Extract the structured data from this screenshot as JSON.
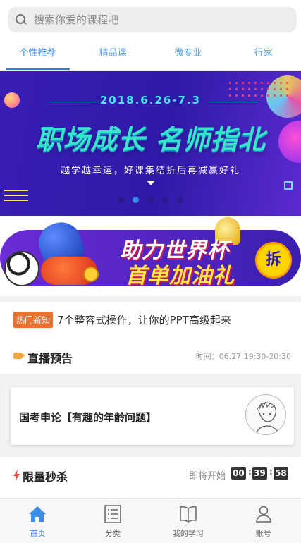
{
  "search": {
    "placeholder": "搜索你爱的课程吧"
  },
  "tabs": [
    {
      "label": "个性推荐",
      "active": true
    },
    {
      "label": "精品课"
    },
    {
      "label": "微专业"
    },
    {
      "label": "行家"
    }
  ],
  "banner": {
    "date": "2018.6.26-7.3",
    "title": "职场成长 名师指北",
    "subtitle": "越学越幸运，好课集结折后再减赢好礼",
    "slide_count": 5,
    "active_slide": 2
  },
  "promo": {
    "line1": "助力世界杯",
    "line2": "首单加油礼",
    "badge": "拆"
  },
  "news": {
    "tag": "热门新知",
    "text": "7个整容式操作，让你的PPT高级起来"
  },
  "live": {
    "label": "直播预告",
    "time": "时间：06.27 19:30-20:30",
    "card_title": "国考申论【有趣的年龄问题】"
  },
  "flash_sale": {
    "label": "限量秒杀",
    "status": "即将开始",
    "hours": "00",
    "minutes": "39",
    "seconds": "58"
  },
  "nav": [
    {
      "label": "首页",
      "icon": "home-icon",
      "active": true
    },
    {
      "label": "分类",
      "icon": "list-icon"
    },
    {
      "label": "我的学习",
      "icon": "book-icon"
    },
    {
      "label": "账号",
      "icon": "user-icon"
    }
  ],
  "colors": {
    "accent": "#2f7fe0",
    "tag": "#e8722f",
    "banner_bg": "#3a1db5"
  }
}
